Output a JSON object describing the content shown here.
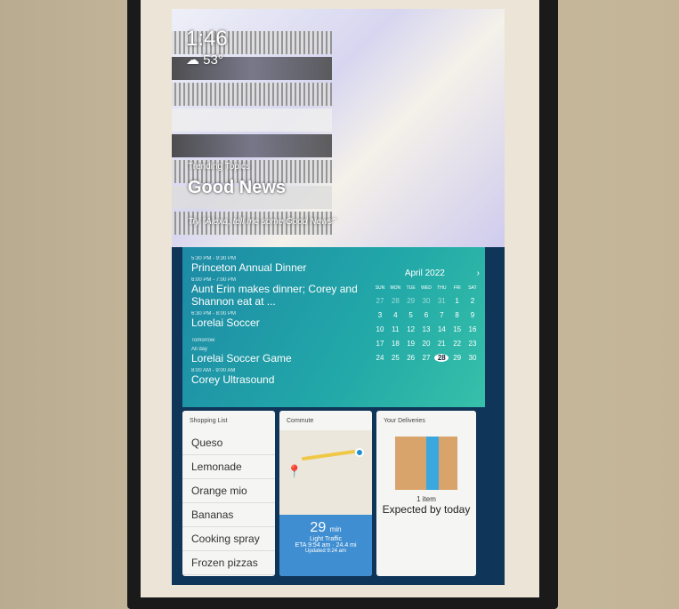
{
  "clock": {
    "time": "1:46",
    "weather_icon": "cloud-rain-icon",
    "temperature": "53°"
  },
  "trending": {
    "label": "Trending Topics",
    "title": "Good News",
    "hint": "Try \"Alexa, tell me some Good News\""
  },
  "agenda": [
    {
      "time": "5:30 PM - 9:30 PM",
      "title": "Princeton Annual Dinner"
    },
    {
      "time": "6:00 PM - 7:00 PM",
      "title": "Aunt Erin makes dinner; Corey and Shannon eat at ..."
    },
    {
      "time": "6:30 PM - 8:00 PM",
      "title": "Lorelai Soccer"
    }
  ],
  "tomorrow": {
    "label": "Tomorrow",
    "events": [
      {
        "time": "All day",
        "title": "Lorelai Soccer Game"
      },
      {
        "time": "8:00 AM - 9:00 AM",
        "title": "Corey Ultrasound"
      }
    ]
  },
  "calendar": {
    "month": "April 2022",
    "days_of_week": [
      "SUN",
      "MON",
      "TUE",
      "WED",
      "THU",
      "FRI",
      "SAT"
    ],
    "weeks": [
      [
        "27",
        "28",
        "29",
        "30",
        "31",
        "1",
        "2"
      ],
      [
        "3",
        "4",
        "5",
        "6",
        "7",
        "8",
        "9"
      ],
      [
        "10",
        "11",
        "12",
        "13",
        "14",
        "15",
        "16"
      ],
      [
        "17",
        "18",
        "19",
        "20",
        "21",
        "22",
        "23"
      ],
      [
        "24",
        "25",
        "26",
        "27",
        "28",
        "29",
        "30"
      ]
    ],
    "today": "28"
  },
  "shopping": {
    "title": "Shopping List",
    "items": [
      "Queso",
      "Lemonade",
      "Orange mio",
      "Bananas",
      "Cooking spray",
      "Frozen pizzas"
    ]
  },
  "commute": {
    "title": "Commute",
    "duration": "29",
    "unit": "min",
    "traffic": "Light Traffic",
    "eta": "ETA 9:54 am · 24.4 mi",
    "updated": "Updated 9:24 am"
  },
  "deliveries": {
    "title": "Your Deliveries",
    "count": "1 item",
    "status": "Expected by today"
  }
}
